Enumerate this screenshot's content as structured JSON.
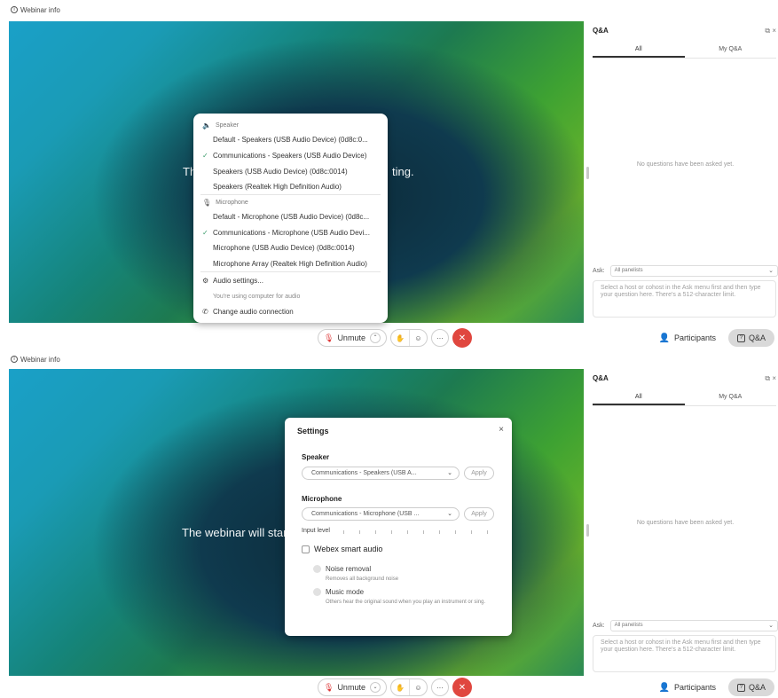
{
  "webinar_info_label": "Webinar info",
  "top": {
    "stage_text_left": "Th",
    "stage_text_right": "ting.",
    "menu": {
      "speaker_section": "Speaker",
      "speaker_items": [
        {
          "label": "Default - Speakers (USB Audio Device) (0d8c:0...",
          "checked": false
        },
        {
          "label": "Communications - Speakers (USB Audio Device)",
          "checked": true
        },
        {
          "label": "Speakers (USB Audio Device) (0d8c:0014)",
          "checked": false
        },
        {
          "label": "Speakers (Realtek High Definition Audio)",
          "checked": false
        }
      ],
      "microphone_section": "Microphone",
      "microphone_items": [
        {
          "label": "Default - Microphone (USB Audio Device) (0d8c...",
          "checked": false
        },
        {
          "label": "Communications - Microphone (USB Audio Devi...",
          "checked": true
        },
        {
          "label": "Microphone (USB Audio Device) (0d8c:0014)",
          "checked": false
        },
        {
          "label": "Microphone Array (Realtek High Definition Audio)",
          "checked": false
        }
      ],
      "audio_settings": "Audio settings...",
      "using_computer_hint": "You're using computer for audio",
      "change_connection": "Change audio connection"
    }
  },
  "bottom": {
    "stage_text": "The webinar will start",
    "settings": {
      "title": "Settings",
      "speaker_label": "Speaker",
      "speaker_value": "Communications - Speakers (USB A...",
      "apply_label": "Apply",
      "microphone_label": "Microphone",
      "microphone_value": "Communications - Microphone (USB ...",
      "input_level_label": "Input level",
      "smart_audio_label": "Webex smart audio",
      "noise_removal_label": "Noise removal",
      "noise_removal_desc": "Removes all background noise",
      "music_mode_label": "Music mode",
      "music_mode_desc": "Others hear the original sound when you play an instrument or sing."
    }
  },
  "qa_panel": {
    "title": "Q&A",
    "tabs": [
      "All",
      "My Q&A"
    ],
    "empty_message": "No questions have been asked yet.",
    "ask_label": "Ask:",
    "ask_value": "All panelists",
    "question_placeholder": "Select a host or cohost in the Ask menu first and then type your question here. There's a 512-character limit."
  },
  "controls": {
    "unmute_label": "Unmute",
    "participants_label": "Participants",
    "qa_label": "Q&A"
  },
  "colors": {
    "leave_red": "#e0473f",
    "check_green": "#3b9b6b"
  }
}
